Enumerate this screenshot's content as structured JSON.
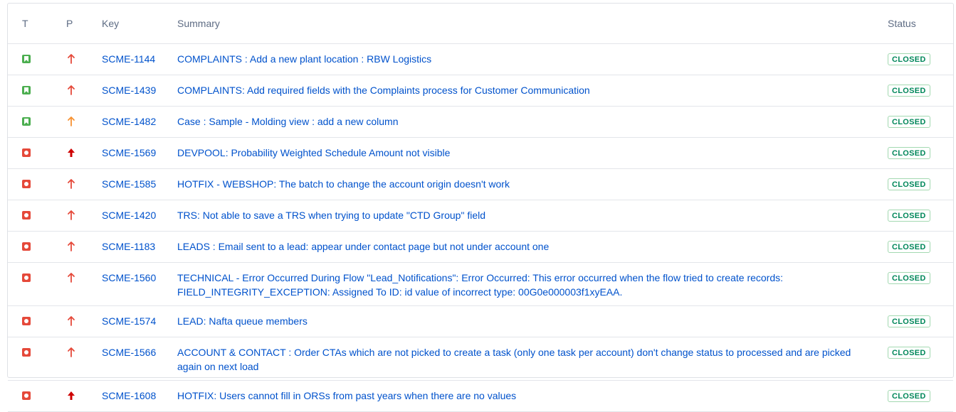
{
  "headers": {
    "type": "T",
    "priority": "P",
    "key": "Key",
    "summary": "Summary",
    "status": "Status"
  },
  "colors": {
    "story": "#4bae4f",
    "bug": "#e5493a",
    "priority_high": "#e5493a",
    "priority_highest": "#ce0000",
    "priority_medium": "#f79232",
    "link": "#0052cc"
  },
  "rows": [
    {
      "type": "story",
      "priority": "high",
      "key": "SCME-1144",
      "summary": "COMPLAINTS : Add a new plant location : RBW Logistics",
      "status": "CLOSED"
    },
    {
      "type": "story",
      "priority": "high",
      "key": "SCME-1439",
      "summary": "COMPLAINTS: Add required fields with the Complaints process for Customer Communication",
      "status": "CLOSED"
    },
    {
      "type": "story",
      "priority": "medium",
      "key": "SCME-1482",
      "summary": "Case : Sample - Molding view : add a new column",
      "status": "CLOSED"
    },
    {
      "type": "bug",
      "priority": "highest",
      "key": "SCME-1569",
      "summary": "DEVPOOL: Probability Weighted Schedule Amount not visible",
      "status": "CLOSED"
    },
    {
      "type": "bug",
      "priority": "high",
      "key": "SCME-1585",
      "summary": "HOTFIX - WEBSHOP: The batch to change the account origin doesn't work",
      "status": "CLOSED"
    },
    {
      "type": "bug",
      "priority": "high",
      "key": "SCME-1420",
      "summary": "TRS: Not able to save a TRS when trying to update \"CTD Group\" field",
      "status": "CLOSED"
    },
    {
      "type": "bug",
      "priority": "high",
      "key": "SCME-1183",
      "summary": "LEADS : Email sent to a lead: appear under contact page but not under account one",
      "status": "CLOSED"
    },
    {
      "type": "bug",
      "priority": "high",
      "key": "SCME-1560",
      "summary": "TECHNICAL - Error Occurred During Flow \"Lead_Notifications\": Error Occurred: This error occurred when the flow tried to create records: FIELD_INTEGRITY_EXCEPTION: Assigned To ID: id value of incorrect type: 00G0e000003f1xyEAA.",
      "status": "CLOSED"
    },
    {
      "type": "bug",
      "priority": "high",
      "key": "SCME-1574",
      "summary": "LEAD: Nafta queue members",
      "status": "CLOSED"
    },
    {
      "type": "bug",
      "priority": "high",
      "key": "SCME-1566",
      "summary": "ACCOUNT & CONTACT : Order CTAs which are not picked to create a task (only one task per account) don't change status to processed and are picked again on next load",
      "status": "CLOSED"
    },
    {
      "type": "bug",
      "priority": "highest",
      "key": "SCME-1608",
      "summary": "HOTFIX: Users cannot fill in ORSs from past years when there are no values",
      "status": "CLOSED"
    }
  ]
}
